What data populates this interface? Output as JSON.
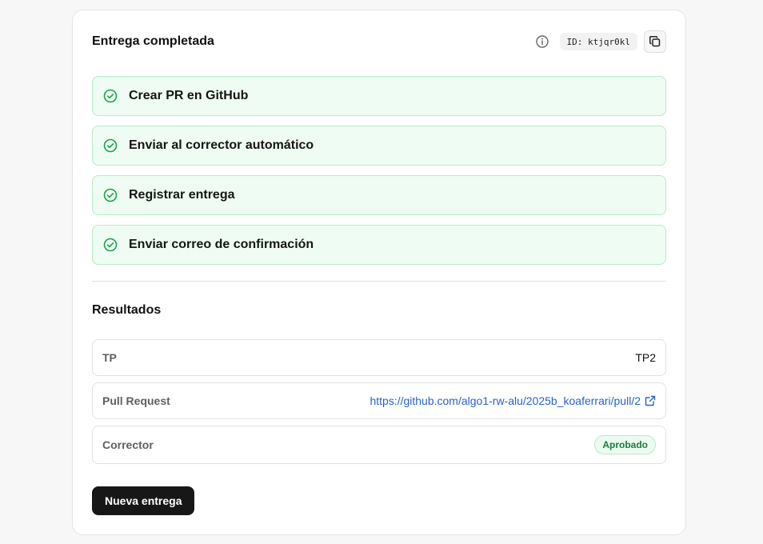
{
  "header": {
    "title": "Entrega completada",
    "id_label": "ID: ktjqr0kl",
    "icons": {
      "info": "info-circle-icon",
      "copy": "copy-icon"
    }
  },
  "steps": [
    {
      "label": "Crear PR en GitHub",
      "status": "completed",
      "icon": "check-circle-icon"
    },
    {
      "label": "Enviar al corrector automático",
      "status": "completed",
      "icon": "check-circle-icon"
    },
    {
      "label": "Registrar entrega",
      "status": "completed",
      "icon": "check-circle-icon"
    },
    {
      "label": "Enviar correo de confirmación",
      "status": "completed",
      "icon": "check-circle-icon"
    }
  ],
  "results": {
    "title": "Resultados",
    "rows": [
      {
        "label": "TP",
        "value": "TP2"
      },
      {
        "label": "Pull Request",
        "value": "https://github.com/algo1-rw-alu/2025b_koaferrari/pull/2",
        "icon": "external-link-icon"
      },
      {
        "label": "Corrector",
        "value": "Aprobado"
      }
    ]
  },
  "actions": {
    "new_submission": "Nueva entrega"
  },
  "colors": {
    "success": "#16a34a",
    "success_bg": "#effcf3",
    "link": "#2563c9",
    "primary_button": "#171717"
  }
}
